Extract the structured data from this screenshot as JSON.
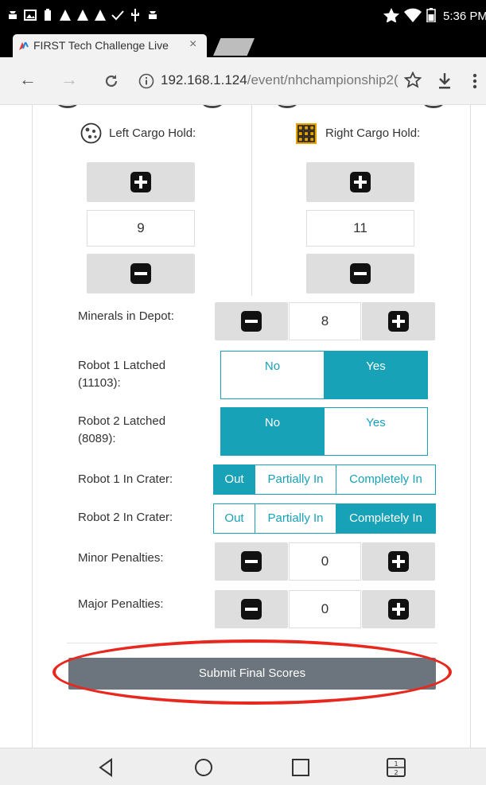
{
  "status_bar": {
    "time": "5:36 PM",
    "left_icons": [
      "android-icon",
      "image-icon",
      "battery-icon",
      "alert-icon",
      "alert-icon",
      "alert-icon",
      "check-icon",
      "usb-icon",
      "android-icon"
    ],
    "right_icons": [
      "star-icon",
      "wifi-icon",
      "battery-icon"
    ]
  },
  "browser": {
    "tab_title": "FIRST Tech Challenge Live",
    "url_host": "192.168.1.124",
    "url_path": "/event/nhchampionship2("
  },
  "scoring": {
    "left_cargo_label": "Left Cargo Hold:",
    "right_cargo_label": "Right Cargo Hold:",
    "left_cargo_value": "9",
    "right_cargo_value": "11",
    "minerals_depot_label": "Minerals in Depot:",
    "minerals_depot_value": "8",
    "robot1_latched_label": "Robot 1 Latched (11103):",
    "robot2_latched_label": "Robot 2 Latched (8089):",
    "latched_options": [
      "No",
      "Yes"
    ],
    "robot1_latched_selected": "Yes",
    "robot2_latched_selected": "No",
    "robot1_crater_label": "Robot 1 In Crater:",
    "robot2_crater_label": "Robot 2 In Crater:",
    "crater_options": [
      "Out",
      "Partially In",
      "Completely In"
    ],
    "robot1_crater_selected": "Out",
    "robot2_crater_selected": "Completely In",
    "minor_penalties_label": "Minor Penalties:",
    "minor_penalties_value": "0",
    "major_penalties_label": "Major Penalties:",
    "major_penalties_value": "0",
    "submit_label": "Submit Final Scores"
  },
  "colors": {
    "accent": "#17a2b8",
    "submit_bg": "#6c757d",
    "highlight": "#e8281e"
  }
}
